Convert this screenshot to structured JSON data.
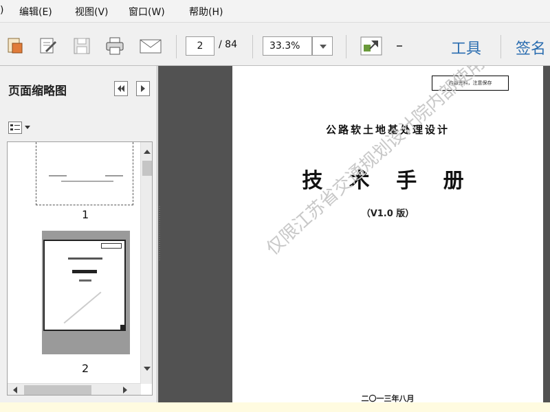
{
  "menu": {
    "items": [
      {
        "label": ")"
      },
      {
        "label": "编辑(E)"
      },
      {
        "label": "视图(V)"
      },
      {
        "label": "窗口(W)"
      },
      {
        "label": "帮助(H)"
      }
    ]
  },
  "toolbar": {
    "icons": [
      "create-pdf-icon",
      "edit-doc-icon",
      "save-icon",
      "print-icon",
      "email-icon",
      "fullscreen-icon",
      "dropdown-arrow-icon"
    ],
    "page_current": "2",
    "page_total": "/ 84",
    "zoom": "33.3%",
    "tools_label": "工具",
    "sign_label": "签名"
  },
  "sidebar": {
    "title": "页面缩略图",
    "thumbnails": [
      {
        "page": "1"
      },
      {
        "page": "2"
      }
    ]
  },
  "document": {
    "notice": "内部资料，注意保存",
    "title": "公路软土地基处理设计",
    "main_title": "技 术 手 册",
    "version": "（V1.0 版）",
    "watermark": "仅限江苏省交通规划设计院内部使用",
    "date": "二〇一三年八月"
  },
  "colors": {
    "accent": "#2a6db0",
    "doc_background": "#525252",
    "status_bar": "#fffbe0"
  }
}
